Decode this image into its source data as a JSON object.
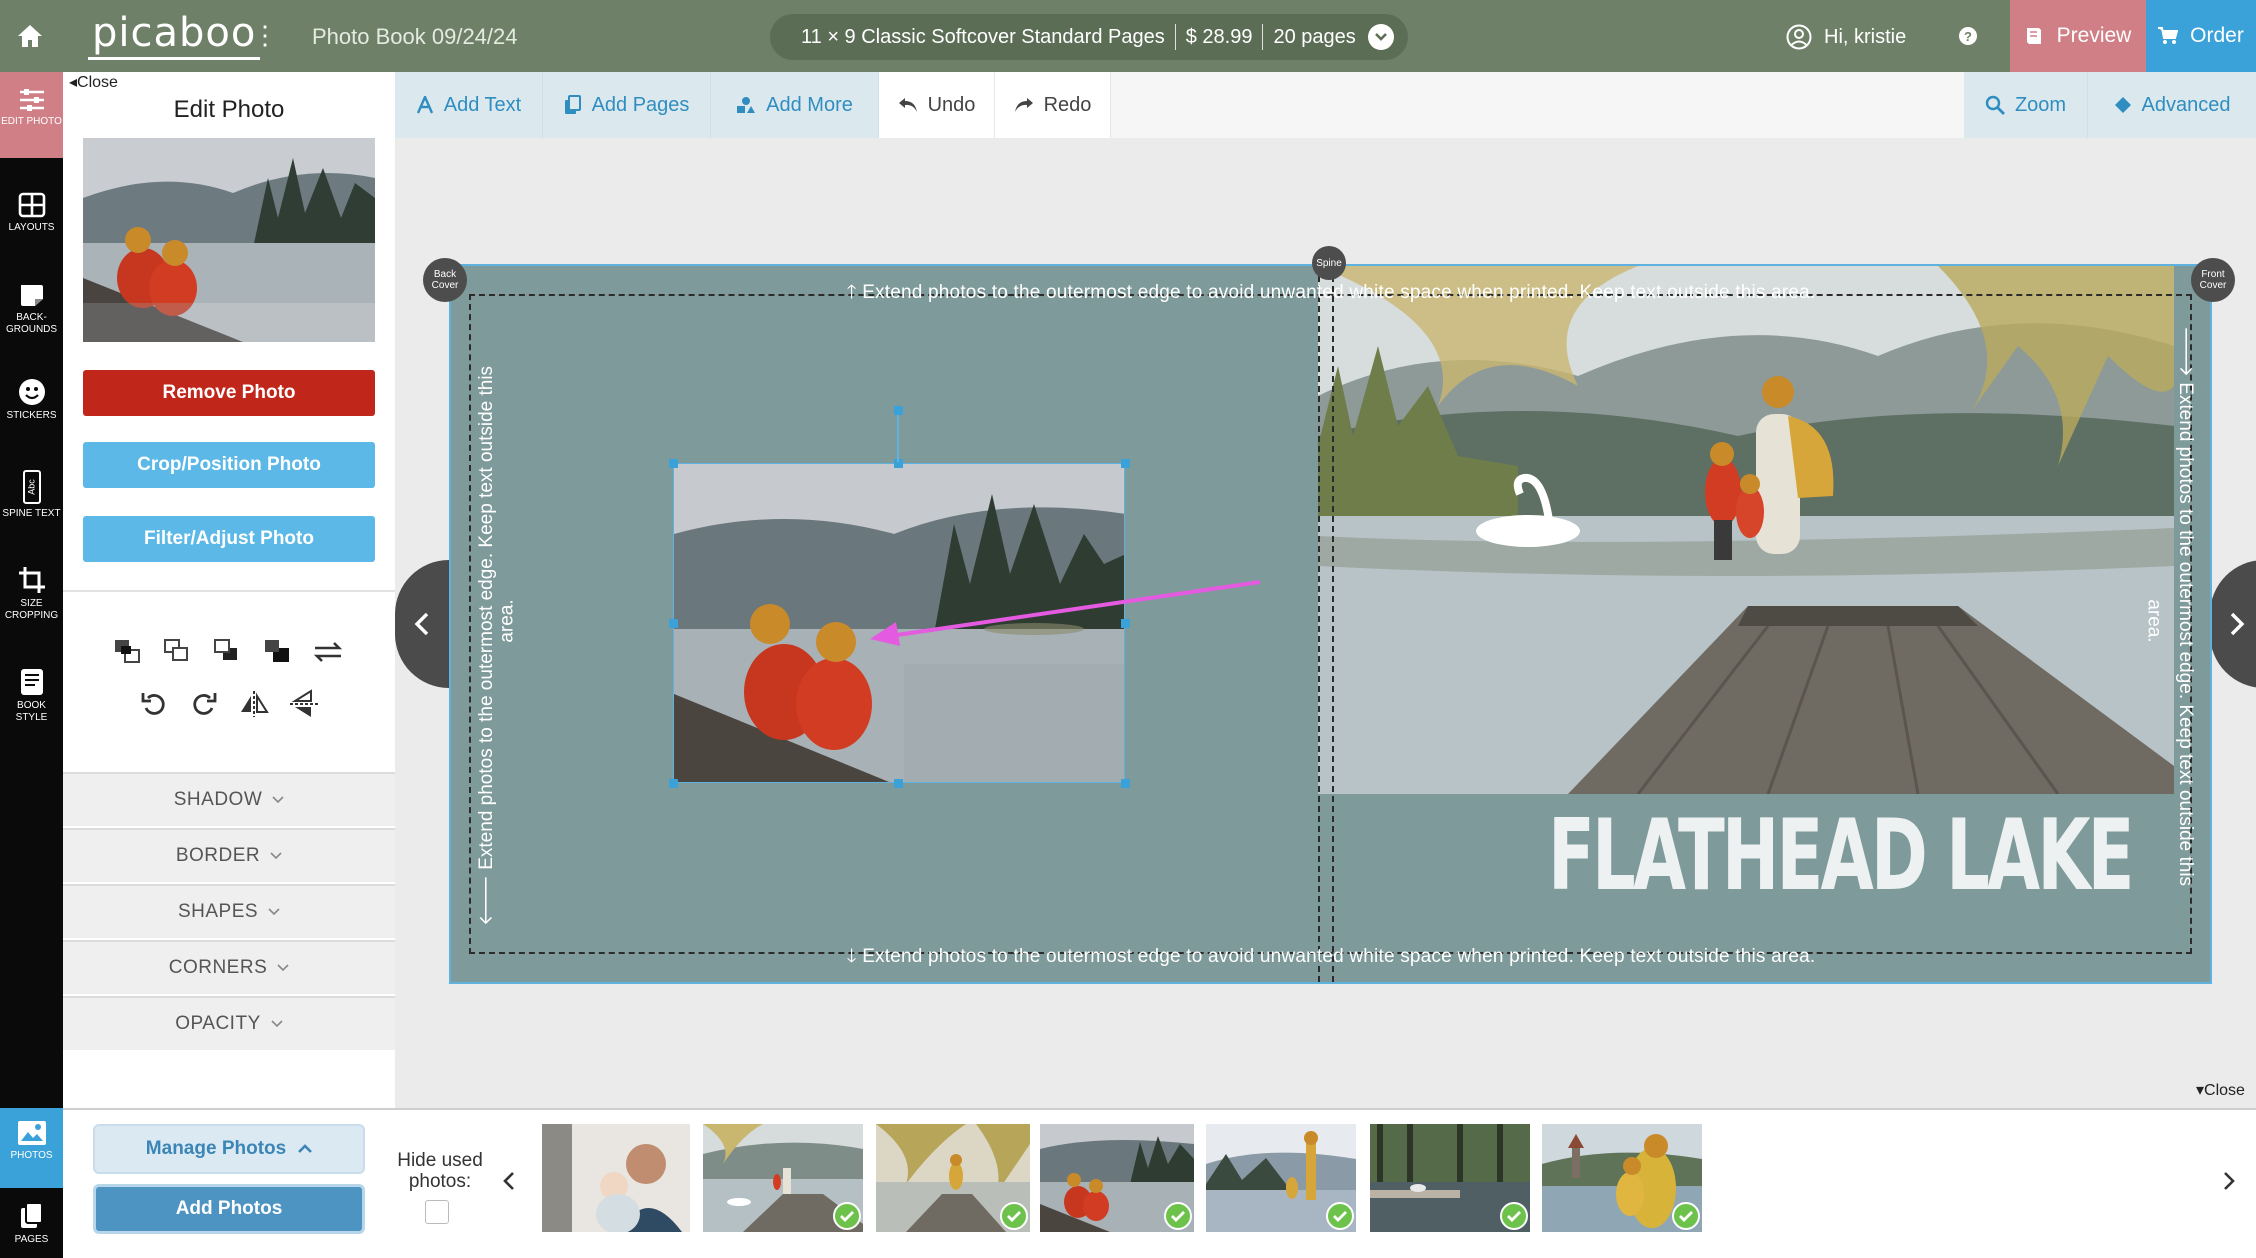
{
  "topbar": {
    "logo": "picaboo",
    "book_title": "Photo Book 09/24/24",
    "product": {
      "description": "11 × 9 Classic Softcover Standard Pages",
      "price": "$ 28.99",
      "pages": "20 pages"
    },
    "greeting": "Hi, kristie",
    "preview_label": "Preview",
    "order_label": "Order"
  },
  "rail": {
    "items": [
      {
        "label": "EDIT PHOTO",
        "icon": "sliders-icon"
      },
      {
        "label": "LAYOUTS",
        "icon": "grid-icon"
      },
      {
        "label": "BACK-GROUNDS",
        "icon": "background-icon"
      },
      {
        "label": "STICKERS",
        "icon": "smiley-icon"
      },
      {
        "label": "SPINE TEXT",
        "icon": "spine-text-icon"
      },
      {
        "label": "SIZE CROPPING",
        "icon": "crop-icon"
      },
      {
        "label": "BOOK STYLE",
        "icon": "book-icon"
      },
      {
        "label": "PHOTOS",
        "icon": "image-icon"
      },
      {
        "label": "PAGES",
        "icon": "pages-icon"
      }
    ]
  },
  "panel": {
    "close_label": "Close",
    "title": "Edit Photo",
    "remove_label": "Remove Photo",
    "crop_label": "Crop/Position Photo",
    "filter_label": "Filter/Adjust Photo",
    "accordions": [
      "SHADOW",
      "BORDER",
      "SHAPES",
      "CORNERS",
      "OPACITY"
    ]
  },
  "toolbar": {
    "add_text": "Add Text",
    "add_pages": "Add Pages",
    "add_more": "Add More",
    "undo": "Undo",
    "redo": "Redo",
    "zoom": "Zoom",
    "advanced": "Advanced"
  },
  "canvas": {
    "back_cover": "Back Cover",
    "front_cover": "Front Cover",
    "spine": "Spine",
    "warning_h": "Extend photos to the outermost edge to avoid unwanted white space when printed. Keep text outside this area.",
    "warning_v": "Extend photos to the outermost edge. Keep text outside this",
    "warning_v_end": "area.",
    "cover_title": "FLATHEAD LAKE",
    "close_label": "Close",
    "colors": {
      "background": "#7f9a9a",
      "selection": "#5fb1e0",
      "arrow": "#e45ae0"
    }
  },
  "tray": {
    "manage_label": "Manage Photos",
    "add_label": "Add Photos",
    "hide_used_label": "Hide used photos:",
    "photos": [
      {
        "subject": "father-and-baby",
        "used": false
      },
      {
        "subject": "lake-dock-swan",
        "used": true
      },
      {
        "subject": "lake-dock-child",
        "used": true
      },
      {
        "subject": "children-at-lake",
        "used": true
      },
      {
        "subject": "family-on-lakeshore",
        "used": true
      },
      {
        "subject": "dock-in-forest",
        "used": true
      },
      {
        "subject": "family-with-castle",
        "used": true
      }
    ]
  }
}
